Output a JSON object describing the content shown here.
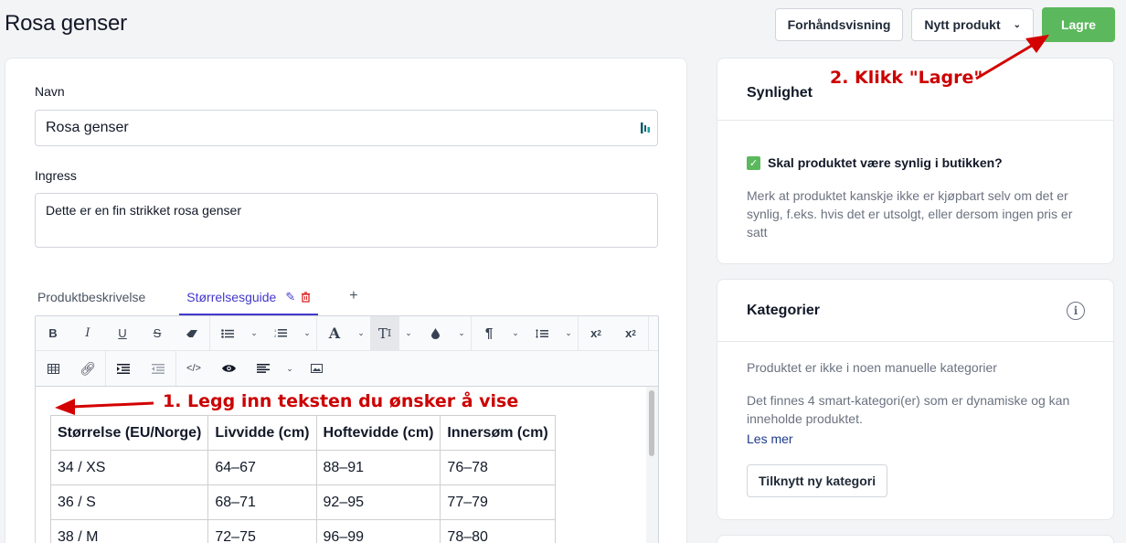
{
  "page": {
    "title": "Rosa genser"
  },
  "actions": {
    "preview_label": "Forhåndsvisning",
    "new_product_label": "Nytt produkt",
    "save_label": "Lagre"
  },
  "form": {
    "name_label": "Navn",
    "name_value": "Rosa genser",
    "intro_label": "Ingress",
    "intro_value": "Dette er en fin strikket rosa genser"
  },
  "tabs": [
    {
      "label": "Produktbeskrivelse",
      "active": false
    },
    {
      "label": "Størrelsesguide",
      "active": true
    }
  ],
  "tab_add_label": "+",
  "toolbar": {
    "row1": [
      "bold-icon",
      "italic-icon",
      "underline-icon",
      "strikethrough-icon",
      "eraser-icon",
      "bullet-list-icon",
      "numbered-list-icon",
      "font-color-icon",
      "text-size-icon",
      "ink-drop-icon",
      "paragraph-icon",
      "line-height-icon",
      "superscript-icon",
      "subscript-icon"
    ],
    "row2": [
      "table-icon",
      "link-icon",
      "indent-icon",
      "outdent-icon",
      "code-view-icon",
      "preview-icon",
      "align-icon",
      "image-icon"
    ]
  },
  "size_table": {
    "headers": [
      "Størrelse (EU/Norge)",
      "Livvidde (cm)",
      "Hoftevidde (cm)",
      "Innersøm (cm)"
    ],
    "rows": [
      [
        "34 / XS",
        "64–67",
        "88–91",
        "76–78"
      ],
      [
        "36 / S",
        "68–71",
        "92–95",
        "77–79"
      ],
      [
        "38 / M",
        "72–75",
        "96–99",
        "78–80"
      ]
    ]
  },
  "visibility": {
    "title": "Synlighet",
    "checkbox_label": "Skal produktet være synlig i butikken?",
    "checked": true,
    "help": "Merk at produktet kanskje ikke er kjøpbart selv om det er synlig, f.eks. hvis det er utsolgt, eller dersom ingen pris er satt"
  },
  "categories": {
    "title": "Kategorier",
    "no_manual": "Produktet er ikke i noen manuelle kategorier",
    "smart_info": "Det finnes 4 smart-kategori(er) som er dynamiske og kan inneholde produktet.",
    "read_more": "Les mer",
    "add_button": "Tilknytt ny kategori"
  },
  "annotations": {
    "step1": "1. Legg inn teksten du ønsker å vise",
    "step2": "2. Klikk \"Lagre\"",
    "color": "#cc0000"
  },
  "colors": {
    "primary": "#5cb85c",
    "accent": "#4338ca",
    "link": "#1e3a8a"
  }
}
